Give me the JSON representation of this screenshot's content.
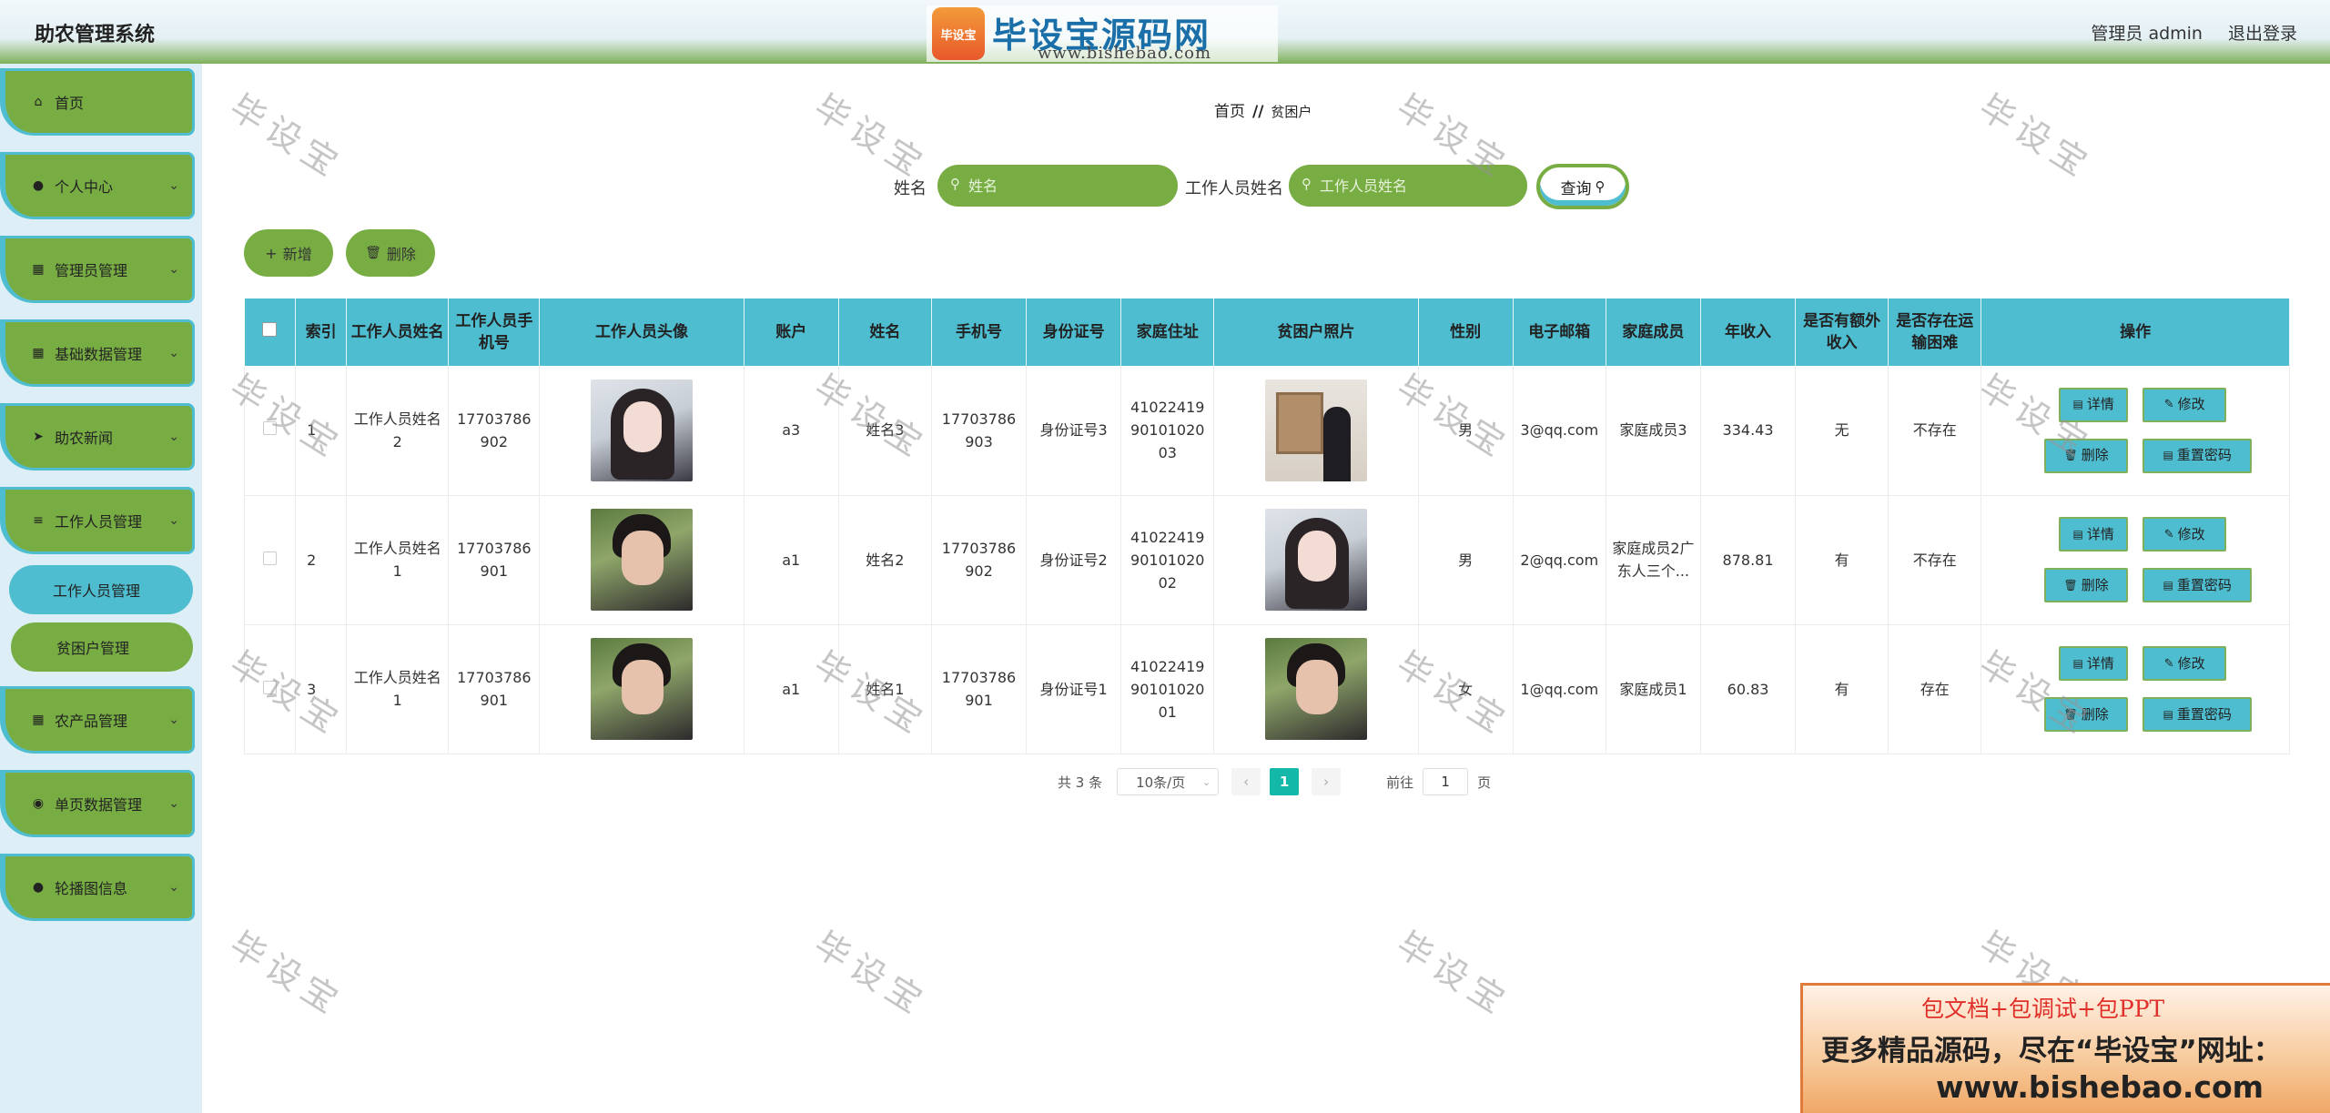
{
  "header": {
    "app_title": "助农管理系统",
    "logo_badge": "毕设宝",
    "logo_main": "毕设宝源码网",
    "logo_url": "www.bishebao.com",
    "user_label": "管理员 admin",
    "logout_label": "退出登录"
  },
  "sidebar": {
    "items": [
      {
        "label": "首页",
        "icon": "home-icon"
      },
      {
        "label": "个人中心",
        "icon": "user-icon"
      },
      {
        "label": "管理员管理",
        "icon": "grid-icon"
      },
      {
        "label": "基础数据管理",
        "icon": "grid-icon"
      },
      {
        "label": "助农新闻",
        "icon": "send-icon"
      },
      {
        "label": "工作人员管理",
        "icon": "menu-icon"
      },
      {
        "label": "农产品管理",
        "icon": "grid-icon"
      },
      {
        "label": "单页数据管理",
        "icon": "pin-icon"
      },
      {
        "label": "轮播图信息",
        "icon": "user-icon"
      }
    ],
    "sub_items": [
      {
        "label": "工作人员管理",
        "active": true
      },
      {
        "label": "贫困户管理",
        "active": false
      }
    ]
  },
  "breadcrumb": {
    "home": "首页",
    "sep": "//",
    "current": "贫困户"
  },
  "search": {
    "name_label": "姓名",
    "name_placeholder": "姓名",
    "staff_label": "工作人员姓名",
    "staff_placeholder": "工作人员姓名",
    "query_label": "查询"
  },
  "actions": {
    "add_label": "新增",
    "delete_label": "删除"
  },
  "table": {
    "headers": [
      "索引",
      "工作人员姓名",
      "工作人员手机号",
      "工作人员头像",
      "账户",
      "姓名",
      "手机号",
      "身份证号",
      "家庭住址",
      "贫困户照片",
      "性别",
      "电子邮箱",
      "家庭成员",
      "年收入",
      "是否有额外收入",
      "是否存在运输困难",
      "操作"
    ],
    "rows": [
      {
        "index": "1",
        "staff_name": "工作人员姓名2",
        "staff_phone": "17703786902",
        "staff_avatar": "girl",
        "account": "a3",
        "name": "姓名3",
        "phone": "17703786903",
        "id_card": "身份证号3",
        "address": "410224199010102003",
        "photo": "art",
        "gender": "男",
        "email": "3@qq.com",
        "family": "家庭成员3",
        "income": "334.43",
        "extra_income": "无",
        "transport": "不存在"
      },
      {
        "index": "2",
        "staff_name": "工作人员姓名1",
        "staff_phone": "17703786901",
        "staff_avatar": "boy",
        "account": "a1",
        "name": "姓名2",
        "phone": "17703786902",
        "id_card": "身份证号2",
        "address": "410224199010102002",
        "photo": "girl",
        "gender": "男",
        "email": "2@qq.com",
        "family": "家庭成员2广东人三个...",
        "income": "878.81",
        "extra_income": "有",
        "transport": "不存在"
      },
      {
        "index": "3",
        "staff_name": "工作人员姓名1",
        "staff_phone": "17703786901",
        "staff_avatar": "boy",
        "account": "a1",
        "name": "姓名1",
        "phone": "17703786901",
        "id_card": "身份证号1",
        "address": "410224199010102001",
        "photo": "boy",
        "gender": "女",
        "email": "1@qq.com",
        "family": "家庭成员1",
        "income": "60.83",
        "extra_income": "有",
        "transport": "存在"
      }
    ],
    "op_labels": {
      "detail": "详情",
      "edit": "修改",
      "delete": "删除",
      "reset": "重置密码"
    }
  },
  "pagination": {
    "total_text": "共 3 条",
    "page_size": "10条/页",
    "current_page": "1",
    "goto_label": "前往",
    "goto_value": "1",
    "page_unit": "页"
  },
  "watermark": "毕设宝",
  "ad": {
    "line1": "包文档+包调试+包PPT",
    "line2": "更多精品源码，尽在“毕设宝”网址：",
    "line3": "www.bishebao.com"
  }
}
